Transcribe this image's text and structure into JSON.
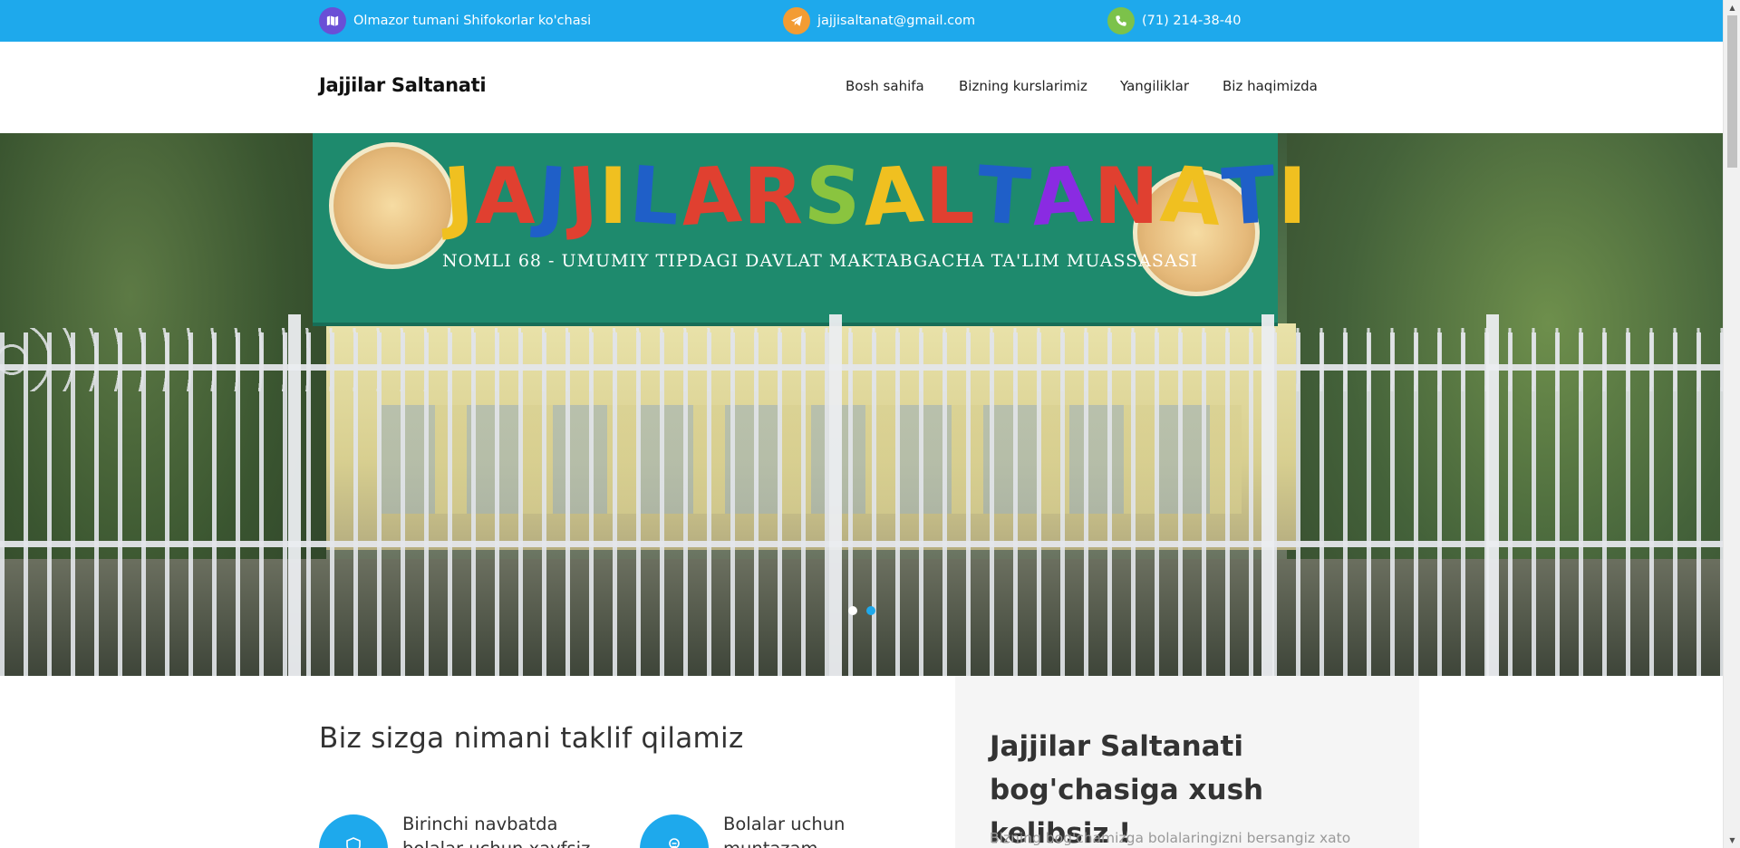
{
  "topbar": {
    "address": "Olmazor tumani Shifokorlar ko'chasi",
    "email": "jajjisaltanat@gmail.com",
    "phone": "(71) 214-38-40",
    "colors": {
      "background": "#1ea9ec",
      "address_icon": "#6a4fd6",
      "email_icon": "#f39c33",
      "phone_icon": "#7cc24a"
    },
    "icons": {
      "address": "map-icon",
      "email": "telegram-icon",
      "phone": "phone-icon"
    }
  },
  "header": {
    "brand": "Jajjilar Saltanati",
    "nav": [
      "Bosh sahifa",
      "Bizning kurslarimiz",
      "Yangiliklar",
      "Biz haqimizda"
    ]
  },
  "hero": {
    "sign_letters": [
      "J",
      "A",
      "J",
      "J",
      "I",
      "L",
      "A",
      "R",
      "S",
      "A",
      "L",
      "T",
      "A",
      "N",
      "A",
      "T",
      "I"
    ],
    "sign_letter_colors": [
      "#f0c020",
      "#e04030",
      "#1f5fc8",
      "#e04030",
      "#f0c020",
      "#1f5fc8",
      "#e04030",
      "#e04030",
      "#8ac43f",
      "#f0c020",
      "#e04030",
      "#1f5fc8",
      "#8a2be2",
      "#e04030",
      "#f0c020",
      "#1f5fc8",
      "#f0c020"
    ],
    "sign_subtitle": "NOMLI 68 - UMUMIY TIPDAGI DAVLAT MAKTABGACHA TA'LIM MUASSASASI",
    "slides": [
      {
        "active": false
      },
      {
        "active": true
      }
    ]
  },
  "offer": {
    "title": "Biz sizga nimani taklif qilamiz",
    "features": [
      {
        "icon": "shield-icon",
        "text": "Birinchi navbatda bolalar uchun xavfsiz"
      },
      {
        "icon": "child-icon",
        "text": "Bolalar uchun muntazam"
      }
    ]
  },
  "welcome": {
    "title": "Jajjilar Saltanati bog'chasiga xush kelibsiz !",
    "text": "Bizning bog'chamizga bolalaringizni bersangiz xato"
  }
}
